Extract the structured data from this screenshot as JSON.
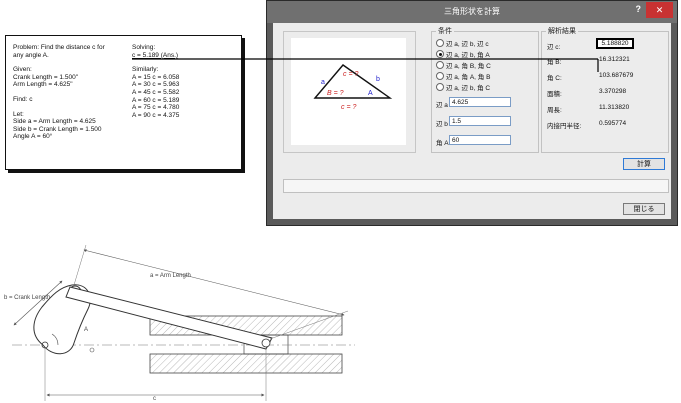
{
  "problem": {
    "left_lines": [
      "Problem: Find the distance c for",
      "any angle A.",
      "",
      "Given:",
      "Crank Length = 1.500\"",
      "Arm Length = 4.625\"",
      "",
      "Find: c",
      "",
      "Let:",
      "Side a = Arm Length = 4.625",
      "Side b = Crank Length = 1.500",
      "Angle A = 60°"
    ],
    "solving_label": "Solving:",
    "solving_value": "c = 5.189 (Ans.)",
    "similarly_label": "Similarly:",
    "similarly_lines": [
      "A = 15   c = 6.058",
      "A = 30   c = 5.963",
      "A = 45   c = 5.582",
      "A = 60   c = 5.189",
      "A = 75   c = 4.780",
      "A = 90   c = 4.375"
    ]
  },
  "dialog": {
    "title": "三角形状を計算",
    "help_label": "?",
    "close_label": "✕",
    "figure": {
      "label_a": "a",
      "label_b": "b",
      "label_c_top": "c = ?",
      "label_B": "B = ?",
      "label_A": "A",
      "label_c_bottom": "c = ?"
    },
    "conditions": {
      "legend": "条件",
      "options": [
        "辺 a, 辺 b, 辺 c",
        "辺 a, 辺 b, 角 A",
        "辺 a, 角 B, 角 C",
        "辺 a, 角 A, 角 B",
        "辺 a, 辺 b, 角 C"
      ],
      "selected_index": 1,
      "field_a_label": "辺 a",
      "field_a_value": "4.625",
      "field_b_label": "辺 b",
      "field_b_value": "1.5",
      "field_A_label": "角 A",
      "field_A_value": "60"
    },
    "results": {
      "legend": "解析結果",
      "rows": [
        {
          "label": "辺 c:",
          "value": "5.188820"
        },
        {
          "label": "角 B:",
          "value": "16.312321"
        },
        {
          "label": "角 C:",
          "value": "103.687679"
        },
        {
          "label": "面積:",
          "value": "3.370298"
        },
        {
          "label": "周長:",
          "value": "11.313820"
        },
        {
          "label": "内接円半径:",
          "value": "0.595774"
        }
      ]
    },
    "calculate_label": "計算",
    "close_button_label": "閉じる",
    "status_text": ""
  },
  "mechanism": {
    "arm_label": "a = Arm Length",
    "crank_label": "b = Crank Length",
    "angle_label": "A",
    "bottom_label": "c"
  },
  "colors": {
    "accent_blue": "#2323cc",
    "accent_red": "#cc2222",
    "title_bar": "#707070",
    "close_red": "#c83232"
  }
}
